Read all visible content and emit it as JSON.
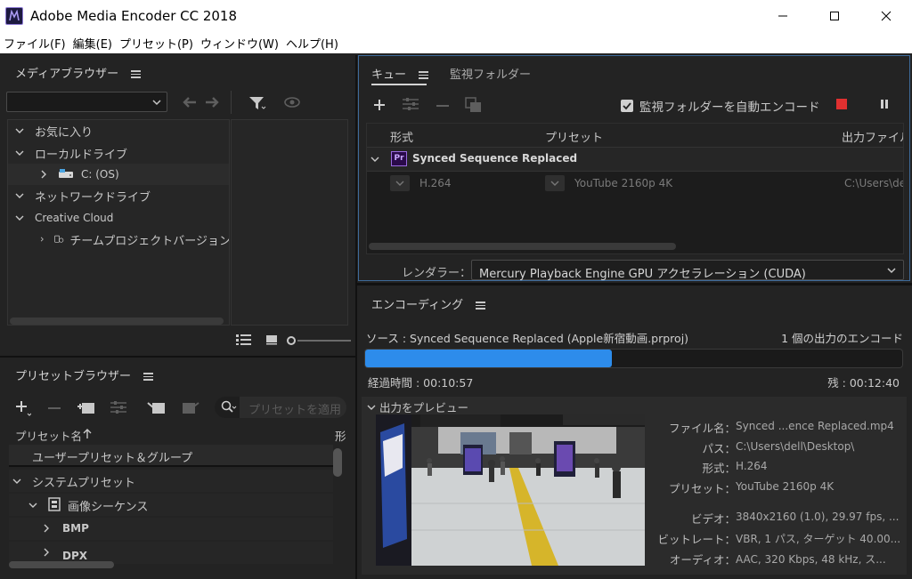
{
  "window": {
    "title": "Adobe Media Encoder CC 2018"
  },
  "menubar": {
    "items": [
      "ファイル(F)",
      "編集(E)",
      "プリセット(P)",
      "ウィンドウ(W)",
      "ヘルプ(H)"
    ]
  },
  "media_browser": {
    "title": "メディアブラウザー",
    "tree": {
      "favorites": "お気に入り",
      "local_drives": "ローカルドライブ",
      "drive_c": "C: (OS)",
      "network_drives": "ネットワークドライブ",
      "creative_cloud": "Creative Cloud",
      "team_projects": "チームプロジェクトバージョン"
    }
  },
  "queue": {
    "tab_queue": "キュー",
    "tab_watch": "監視フォルダー",
    "auto_encode_label": "監視フォルダーを自動エンコード",
    "auto_encode_checked": true,
    "columns": {
      "format": "形式",
      "preset": "プリセット",
      "output": "出力ファイル"
    },
    "item": {
      "name": "Synced Sequence Replaced",
      "format": "H.264",
      "preset": "YouTube 2160p 4K",
      "output": "C:\\Users\\dell"
    },
    "renderer_label": "レンダラー：",
    "renderer_value": "Mercury Playback Engine GPU アクセラレーション (CUDA)"
  },
  "preset_browser": {
    "title": "プリセットブラウザー",
    "search_placeholder": "プリセットを適用",
    "col_name": "プリセット名",
    "col_format": "形",
    "rows": {
      "user": "ユーザープリセット＆グループ",
      "system": "システムプリセット",
      "image_seq": "画像シーケンス",
      "bmp": "BMP",
      "dpx": "DPX"
    }
  },
  "encoding": {
    "title": "エンコーディング",
    "source": "ソース : Synced Sequence Replaced (Apple新宿動画.prproj)",
    "output_count": "1 個の出力のエンコード",
    "progress": 0.46,
    "elapsed": "経過時間 : 00:10:57",
    "remaining": "残 : 00:12:40",
    "preview_label": "出力をプレビュー",
    "details": {
      "filename_label": "ファイル名：",
      "filename_value": "Synced ...ence Replaced.mp4",
      "path_label": "パス：",
      "path_value": "C:\\Users\\dell\\Desktop\\",
      "format_label": "形式：",
      "format_value": "H.264",
      "preset_label": "プリセット：",
      "preset_value": "YouTube 2160p 4K",
      "video_label": "ビデオ：",
      "video_value": "3840x2160 (1.0), 29.97 fps, ...",
      "bitrate_label": "ビットレート：",
      "bitrate_value": "VBR, 1 パス, ターゲット 40.00...",
      "audio_label": "オーディオ：",
      "audio_value": "AAC, 320 Kbps, 48 kHz, ス..."
    }
  },
  "colors": {
    "accent": "#2d8ceb",
    "stop": "#e03030",
    "panel": "#232323"
  }
}
